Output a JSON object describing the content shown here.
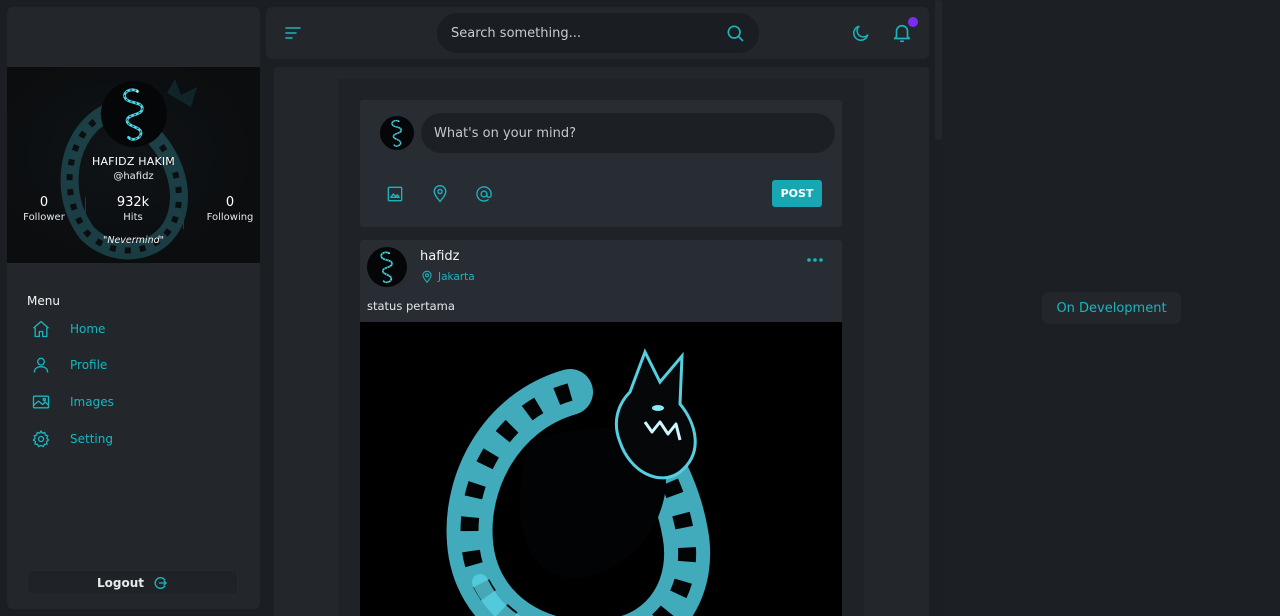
{
  "profile": {
    "name": "HAFIDZ HAKIM",
    "handle": "@hafidz",
    "quote": "\"Nevermind\"",
    "stats": [
      {
        "value": "0",
        "label": "Follower"
      },
      {
        "value": "932k",
        "label": "Hits"
      },
      {
        "value": "0",
        "label": "Following"
      }
    ]
  },
  "menu": {
    "title": "Menu",
    "items": [
      {
        "label": "Home",
        "icon": "home-icon"
      },
      {
        "label": "Profile",
        "icon": "user-icon"
      },
      {
        "label": "Images",
        "icon": "image-icon"
      },
      {
        "label": "Setting",
        "icon": "gear-icon"
      }
    ],
    "logout_label": "Logout"
  },
  "topbar": {
    "search_placeholder": "Search something...",
    "has_notification": true
  },
  "composer": {
    "placeholder": "What's on your mind?",
    "post_label": "POST",
    "tools": [
      "image-icon",
      "location-icon",
      "mention-icon"
    ]
  },
  "post": {
    "author": "hafidz",
    "location": "Jakarta",
    "text": "status pertama"
  },
  "right_panel": {
    "status_label": "On Development"
  },
  "colors": {
    "accent": "#19b5bf",
    "button": "#16a7b3",
    "notification_dot": "#7b2cf0",
    "panel": "#23272c",
    "background": "#1b1e22"
  }
}
